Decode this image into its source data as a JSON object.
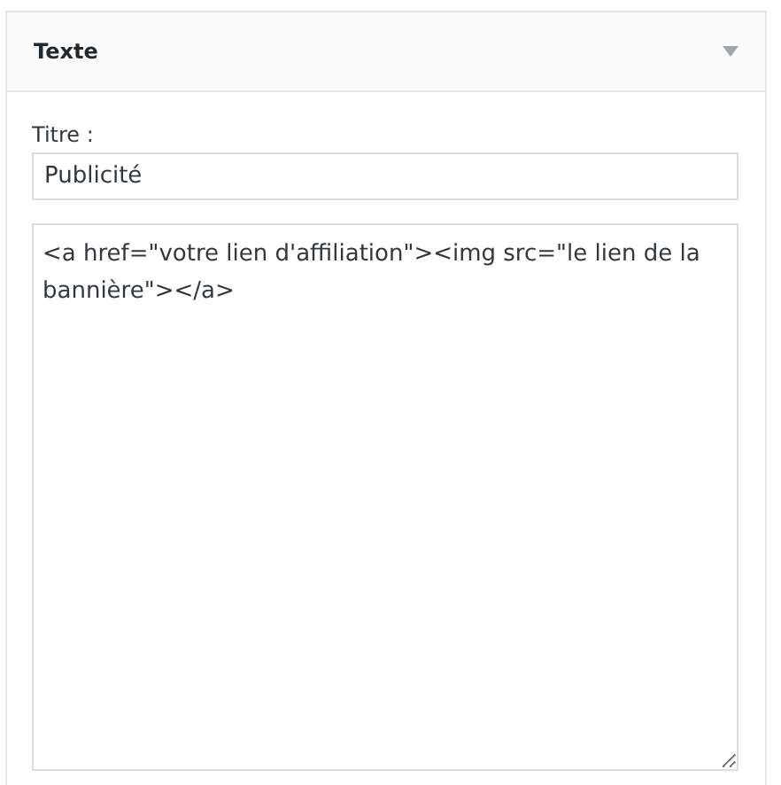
{
  "widget": {
    "title": "Texte",
    "expanded": true
  },
  "title_field": {
    "label": "Titre :",
    "value": "Publicité"
  },
  "content_field": {
    "value": "<a href=\"votre lien d'affiliation\"><img src=\"le lien de la bannière\"></a>"
  }
}
